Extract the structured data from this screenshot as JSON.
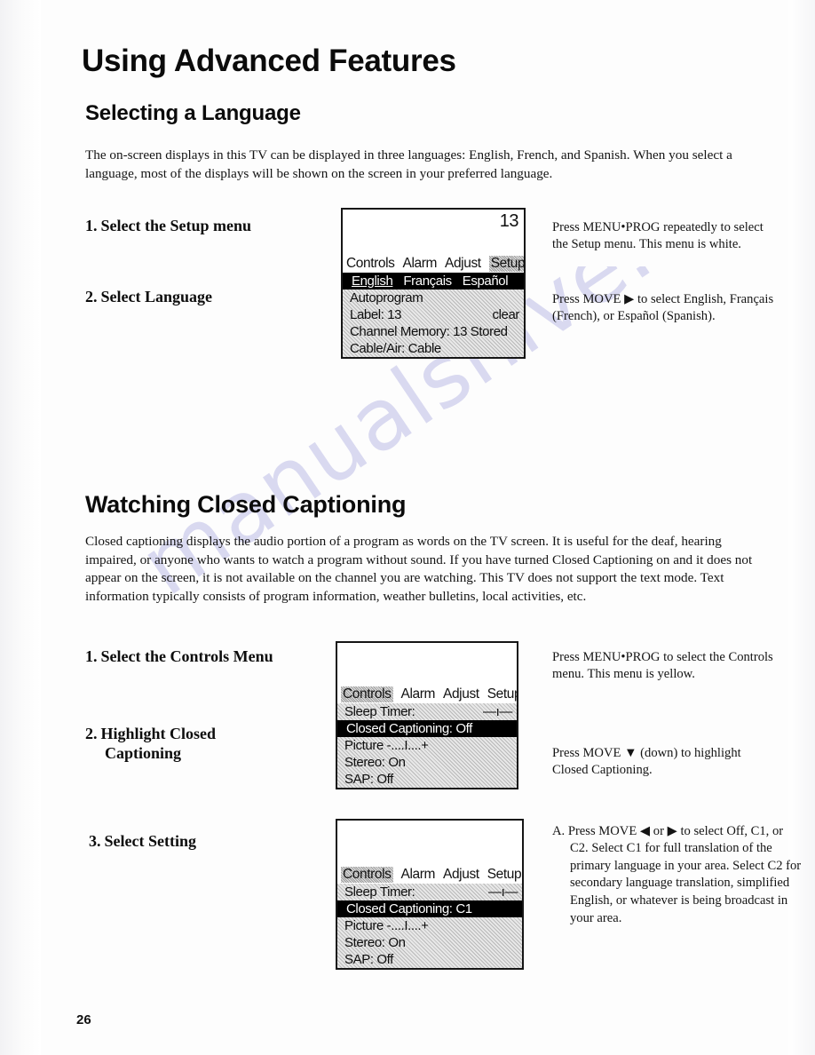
{
  "page": {
    "number": "26",
    "watermark": "manualshive.com"
  },
  "title": "Using Advanced Features",
  "sections": [
    {
      "heading": "Selecting a Language",
      "intro": "The on-screen displays in this TV can be displayed in three languages:  English, French, and Spanish.  When you select a language, most of the displays will be shown on the screen in your preferred language.",
      "steps": [
        {
          "num": "1.",
          "label": "Select the Setup menu"
        },
        {
          "num": "2.",
          "label": "Select Language"
        }
      ],
      "notes": [
        "Press MENU•PROG repeatedly to select the Setup menu.  This menu is white.",
        "Press MOVE ▶ to select English, Français (French), or Español (Spanish)."
      ]
    },
    {
      "heading": "Watching Closed Captioning",
      "intro": "Closed captioning displays the audio portion of a program as words on the TV screen.  It is useful for the deaf, hearing impaired, or anyone who wants to watch a program without sound. If you have turned Closed Captioning on and it does not appear on the screen, it is not available on the channel you are watching.   This TV does not support the text mode.  Text information typically consists of program information, weather bulletins, local activities, etc.",
      "steps": [
        {
          "num": "1.",
          "label": "Select the Controls Menu"
        },
        {
          "num": "2.",
          "label": "Highlight Closed",
          "label_cont": "Captioning"
        },
        {
          "num": "3.",
          "label": "Select Setting"
        }
      ],
      "notes": [
        "Press MENU•PROG to select the Controls menu. This menu is yellow.",
        "Press MOVE ▼ (down) to highlight Closed Captioning.",
        "A. Press MOVE ◀ or ▶ to select Off, C1, or C2.  Select C1 for full translation of the primary language in your area.  Select C2 for secondary language translation, simplified English, or whatever is being broadcast in your area."
      ]
    }
  ],
  "tv_screens": [
    {
      "name": "setup-menu",
      "channel": "13",
      "tabs": [
        "Controls",
        "Alarm",
        "Adjust",
        "Setup"
      ],
      "active_tab": "Setup",
      "highlight_row": {
        "type": "language",
        "options": [
          "English",
          "Français",
          "Español"
        ],
        "selected": "English"
      },
      "rows": [
        {
          "label": "Autoprogram",
          "value": ""
        },
        {
          "label": "Label:  13",
          "value": "clear"
        },
        {
          "label": "Channel Memory: 13 Stored",
          "value": ""
        },
        {
          "label": "Cable/Air: Cable",
          "value": ""
        }
      ]
    },
    {
      "name": "controls-menu-cc-off",
      "channel": "",
      "tabs": [
        "Controls",
        "Alarm",
        "Adjust",
        "Setup"
      ],
      "active_tab": "Controls",
      "rows_before": [
        {
          "label": "Sleep Timer:",
          "value": "—ı—"
        }
      ],
      "highlight_row": {
        "label": "Closed Captioning: Off"
      },
      "rows_after": [
        {
          "label": "Picture  -....I....+",
          "value": ""
        },
        {
          "label": "Stereo:  On",
          "value": ""
        },
        {
          "label": "SAP:  Off",
          "value": ""
        }
      ]
    },
    {
      "name": "controls-menu-cc-c1",
      "channel": "",
      "tabs": [
        "Controls",
        "Alarm",
        "Adjust",
        "Setup"
      ],
      "active_tab": "Controls",
      "rows_before": [
        {
          "label": "Sleep Timer:",
          "value": "—ı—"
        }
      ],
      "highlight_row": {
        "label": "Closed Captioning: C1"
      },
      "rows_after": [
        {
          "label": "Picture  -....I....+",
          "value": ""
        },
        {
          "label": "Stereo:  On",
          "value": ""
        },
        {
          "label": "SAP:  Off",
          "value": ""
        }
      ]
    }
  ]
}
